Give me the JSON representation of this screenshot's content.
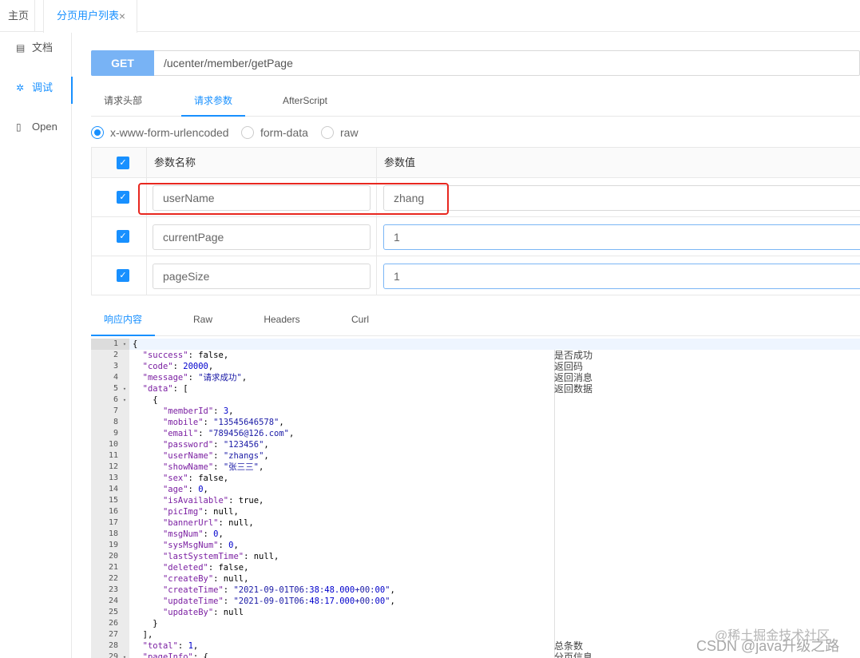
{
  "tabs": {
    "home": "主页",
    "active": "分页用户列表",
    "close_glyph": "×"
  },
  "sidebar": {
    "items": [
      {
        "icon": "document-icon",
        "glyph": "▤",
        "label": "文档"
      },
      {
        "icon": "bug-icon",
        "glyph": "✲",
        "label": "调试"
      },
      {
        "icon": "file-icon",
        "glyph": "▯",
        "label": "Open"
      }
    ]
  },
  "request": {
    "method": "GET",
    "url": "/ucenter/member/getPage"
  },
  "request_tabs": [
    "请求头部",
    "请求参数",
    "AfterScript"
  ],
  "body_types": [
    "x-www-form-urlencoded",
    "form-data",
    "raw"
  ],
  "params": {
    "header_name": "参数名称",
    "header_value": "参数值",
    "rows": [
      {
        "name": "userName",
        "value": "zhang"
      },
      {
        "name": "currentPage",
        "value": "1"
      },
      {
        "name": "pageSize",
        "value": "1"
      }
    ]
  },
  "response_tabs": [
    "响应内容",
    "Raw",
    "Headers",
    "Curl"
  ],
  "response": {
    "lines": [
      {
        "n": "1",
        "fold": "▾",
        "t": "{"
      },
      {
        "n": "2",
        "t": "  \"success\": false,"
      },
      {
        "n": "3",
        "t": "  \"code\": 20000,"
      },
      {
        "n": "4",
        "t": "  \"message\": \"请求成功\","
      },
      {
        "n": "5",
        "fold": "▾",
        "t": "  \"data\": ["
      },
      {
        "n": "6",
        "fold": "▾",
        "t": "    {"
      },
      {
        "n": "7",
        "t": "      \"memberId\": 3,"
      },
      {
        "n": "8",
        "t": "      \"mobile\": \"13545646578\","
      },
      {
        "n": "9",
        "t": "      \"email\": \"789456@126.com\","
      },
      {
        "n": "10",
        "t": "      \"password\": \"123456\","
      },
      {
        "n": "11",
        "t": "      \"userName\": \"zhangs\","
      },
      {
        "n": "12",
        "t": "      \"showName\": \"张三三\","
      },
      {
        "n": "13",
        "t": "      \"sex\": false,"
      },
      {
        "n": "14",
        "t": "      \"age\": 0,"
      },
      {
        "n": "15",
        "t": "      \"isAvailable\": true,"
      },
      {
        "n": "16",
        "t": "      \"picImg\": null,"
      },
      {
        "n": "17",
        "t": "      \"bannerUrl\": null,"
      },
      {
        "n": "18",
        "t": "      \"msgNum\": 0,"
      },
      {
        "n": "19",
        "t": "      \"sysMsgNum\": 0,"
      },
      {
        "n": "20",
        "t": "      \"lastSystemTime\": null,"
      },
      {
        "n": "21",
        "t": "      \"deleted\": false,"
      },
      {
        "n": "22",
        "t": "      \"createBy\": null,"
      },
      {
        "n": "23",
        "t": "      \"createTime\": \"2021-09-01T06:38:48.000+00:00\","
      },
      {
        "n": "24",
        "t": "      \"updateTime\": \"2021-09-01T06:48:17.000+00:00\","
      },
      {
        "n": "25",
        "t": "      \"updateBy\": null"
      },
      {
        "n": "26",
        "t": "    }"
      },
      {
        "n": "27",
        "t": "  ],"
      },
      {
        "n": "28",
        "t": "  \"total\": 1,"
      },
      {
        "n": "29",
        "fold": "▾",
        "t": "  \"pageInfo\": {"
      }
    ],
    "descriptions": [
      {
        "line": 2,
        "text": "是否成功"
      },
      {
        "line": 3,
        "text": "返回码"
      },
      {
        "line": 4,
        "text": "返回消息"
      },
      {
        "line": 5,
        "text": "返回数据"
      },
      {
        "line": 28,
        "text": "总条数"
      },
      {
        "line": 29,
        "text": "分页信息"
      }
    ]
  },
  "watermarks": [
    "@稀土掘金技术社区",
    "CSDN @java升级之路"
  ]
}
